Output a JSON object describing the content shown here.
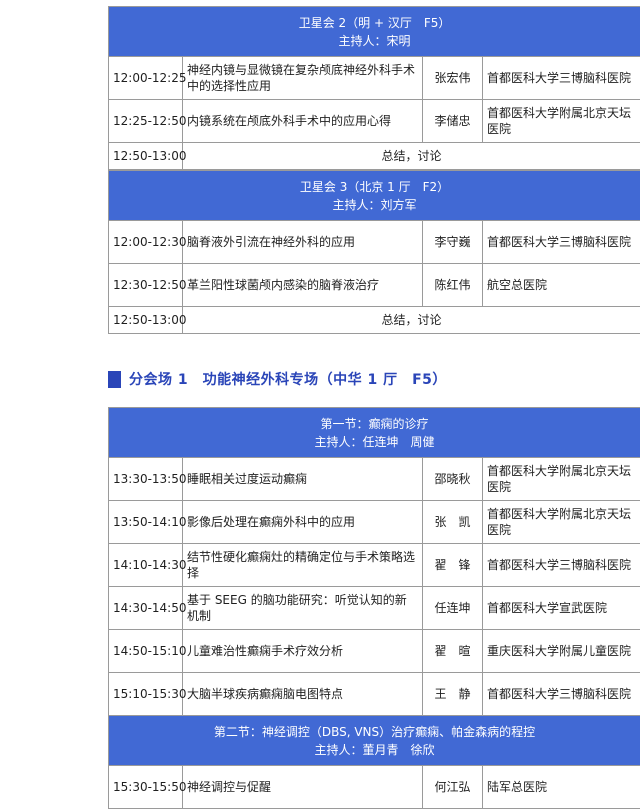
{
  "block1": {
    "header": {
      "title": "卫星会 2（明 + 汉厅　F5）",
      "host": "主持人：宋明"
    },
    "rows": [
      {
        "time": "12:00-12:25",
        "topic": "神经内镜与显微镜在复杂颅底神经外科手术中的选择性应用",
        "speaker": "张宏伟",
        "hospital": "首都医科大学三博脑科医院"
      },
      {
        "time": "12:25-12:50",
        "topic": "内镜系统在颅底外科手术中的应用心得",
        "speaker": "李储忠",
        "hospital": "首都医科大学附属北京天坛医院"
      }
    ],
    "summary": {
      "time": "12:50-13:00",
      "text": "总结，讨论"
    }
  },
  "block2": {
    "header": {
      "title": "卫星会 3（北京 1 厅　F2）",
      "host": "主持人：刘方军"
    },
    "rows": [
      {
        "time": "12:00-12:30",
        "topic": "脑脊液外引流在神经外科的应用",
        "speaker": "李守巍",
        "hospital": "首都医科大学三博脑科医院"
      },
      {
        "time": "12:30-12:50",
        "topic": "革兰阳性球菌颅内感染的脑脊液治疗",
        "speaker": "陈红伟",
        "hospital": "航空总医院"
      }
    ],
    "summary": {
      "time": "12:50-13:00",
      "text": "总结，讨论"
    }
  },
  "section": {
    "title": "分会场 1　功能神经外科专场（中华 1 厅　F5）"
  },
  "block3": {
    "part1": {
      "title": "第一节：癫痫的诊疗",
      "host": "主持人：任连坤　周健"
    },
    "rows": [
      {
        "time": "13:30-13:50",
        "topic": "睡眠相关过度运动癫痫",
        "speaker": "邵晓秋",
        "hospital": "首都医科大学附属北京天坛医院"
      },
      {
        "time": "13:50-14:10",
        "topic": "影像后处理在癫痫外科中的应用",
        "speaker": "张　凯",
        "hospital": "首都医科大学附属北京天坛医院"
      },
      {
        "time": "14:10-14:30",
        "topic": "结节性硬化癫痫灶的精确定位与手术策略选择",
        "speaker": "翟　锋",
        "hospital": "首都医科大学三博脑科医院"
      },
      {
        "time": "14:30-14:50",
        "topic": "基于 SEEG 的脑功能研究：听觉认知的新机制",
        "speaker": "任连坤",
        "hospital": "首都医科大学宣武医院"
      },
      {
        "time": "14:50-15:10",
        "topic": "儿童难治性癫痫手术疗效分析",
        "speaker": "翟　暄",
        "hospital": "重庆医科大学附属儿童医院"
      },
      {
        "time": "15:10-15:30",
        "topic": "大脑半球疾病癫痫脑电图特点",
        "speaker": "王　静",
        "hospital": "首都医科大学三博脑科医院"
      }
    ],
    "part2": {
      "title": "第二节：神经调控（DBS, VNS）治疗癫痫、帕金森病的程控",
      "host": "主持人：董月青　徐欣"
    },
    "rows2": [
      {
        "time": "15:30-15:50",
        "topic": "神经调控与促醒",
        "speaker": "何江弘",
        "hospital": "陆军总医院"
      }
    ]
  }
}
